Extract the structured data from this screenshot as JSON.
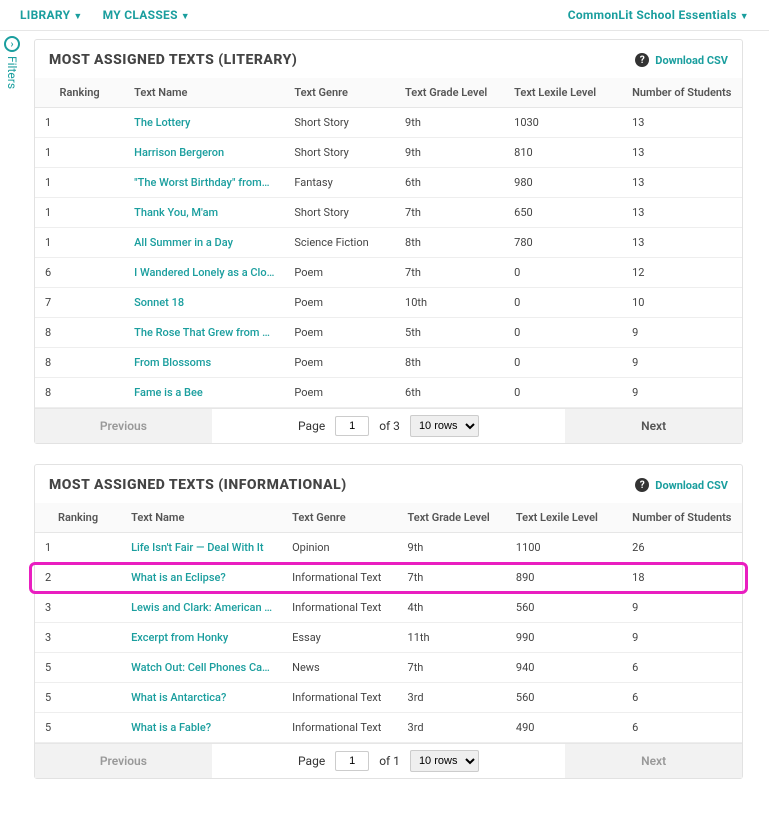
{
  "topbar": {
    "library": "LIBRARY",
    "myclasses": "MY CLASSES",
    "essentials": "CommonLit School Essentials"
  },
  "filters_label": "Filters",
  "download_csv": "Download CSV",
  "columns": {
    "rank": "Ranking",
    "name": "Text Name",
    "genre": "Text Genre",
    "grade": "Text Grade Level",
    "lexile": "Text Lexile Level",
    "students": "Number of Students"
  },
  "pager": {
    "previous": "Previous",
    "next": "Next",
    "page_label": "Page",
    "of_label_lit": "of 3",
    "of_label_info": "of 1",
    "page_value": "1",
    "rows_label": "10 rows"
  },
  "literary": {
    "title": "MOST ASSIGNED TEXTS (LITERARY)",
    "rows": [
      {
        "rank": "1",
        "name": "The Lottery",
        "genre": "Short Story",
        "grade": "9th",
        "lex": "1030",
        "stu": "13"
      },
      {
        "rank": "1",
        "name": "Harrison Bergeron",
        "genre": "Short Story",
        "grade": "9th",
        "lex": "810",
        "stu": "13"
      },
      {
        "rank": "1",
        "name": "\"The Worst Birthday\" from…",
        "genre": "Fantasy",
        "grade": "6th",
        "lex": "980",
        "stu": "13"
      },
      {
        "rank": "1",
        "name": "Thank You, M'am",
        "genre": "Short Story",
        "grade": "7th",
        "lex": "650",
        "stu": "13"
      },
      {
        "rank": "1",
        "name": "All Summer in a Day",
        "genre": "Science Fiction",
        "grade": "8th",
        "lex": "780",
        "stu": "13"
      },
      {
        "rank": "6",
        "name": "I Wandered Lonely as a Clo…",
        "genre": "Poem",
        "grade": "7th",
        "lex": "0",
        "stu": "12"
      },
      {
        "rank": "7",
        "name": "Sonnet 18",
        "genre": "Poem",
        "grade": "10th",
        "lex": "0",
        "stu": "10"
      },
      {
        "rank": "8",
        "name": "The Rose That Grew from …",
        "genre": "Poem",
        "grade": "5th",
        "lex": "0",
        "stu": "9"
      },
      {
        "rank": "8",
        "name": "From Blossoms",
        "genre": "Poem",
        "grade": "8th",
        "lex": "0",
        "stu": "9"
      },
      {
        "rank": "8",
        "name": "Fame is a Bee",
        "genre": "Poem",
        "grade": "6th",
        "lex": "0",
        "stu": "9"
      }
    ]
  },
  "informational": {
    "title": "MOST ASSIGNED TEXTS (INFORMATIONAL)",
    "highlight_index": 1,
    "rows": [
      {
        "rank": "1",
        "name": "Life Isn't Fair — Deal With It",
        "genre": "Opinion",
        "grade": "9th",
        "lex": "1100",
        "stu": "26"
      },
      {
        "rank": "2",
        "name": "What is an Eclipse?",
        "genre": "Informational Text",
        "grade": "7th",
        "lex": "890",
        "stu": "18"
      },
      {
        "rank": "3",
        "name": "Lewis and Clark: American …",
        "genre": "Informational Text",
        "grade": "4th",
        "lex": "560",
        "stu": "9"
      },
      {
        "rank": "3",
        "name": "Excerpt from Honky",
        "genre": "Essay",
        "grade": "11th",
        "lex": "990",
        "stu": "9"
      },
      {
        "rank": "5",
        "name": "Watch Out: Cell Phones Ca…",
        "genre": "News",
        "grade": "7th",
        "lex": "940",
        "stu": "6"
      },
      {
        "rank": "5",
        "name": "What is Antarctica?",
        "genre": "Informational Text",
        "grade": "3rd",
        "lex": "560",
        "stu": "6"
      },
      {
        "rank": "5",
        "name": "What is a Fable?",
        "genre": "Informational Text",
        "grade": "3rd",
        "lex": "490",
        "stu": "6"
      }
    ]
  }
}
